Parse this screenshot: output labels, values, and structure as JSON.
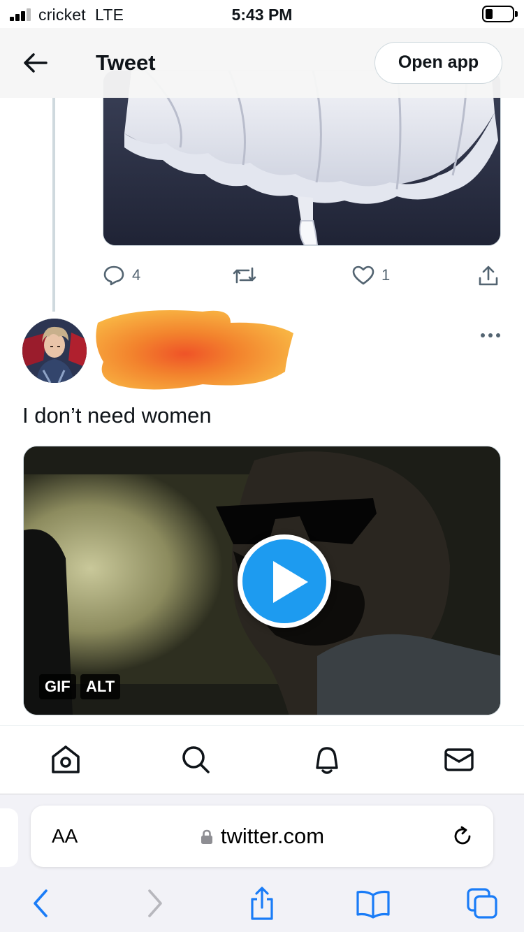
{
  "status_bar": {
    "carrier": "cricket",
    "network": "LTE",
    "time": "5:43 PM"
  },
  "header": {
    "title": "Tweet",
    "open_app_label": "Open app"
  },
  "previous_tweet": {
    "reply_count": "4",
    "like_count": "1"
  },
  "tweet": {
    "text": "I don’t need women",
    "media": {
      "badge_gif": "GIF",
      "badge_alt": "ALT"
    }
  },
  "safari": {
    "text_size_label": "AA",
    "url": "twitter.com"
  },
  "colors": {
    "accent": "#1d9bf0",
    "safari_blue": "#1a7cf7",
    "secondary_text": "#536471",
    "redaction_orange": "#f06a1a"
  }
}
